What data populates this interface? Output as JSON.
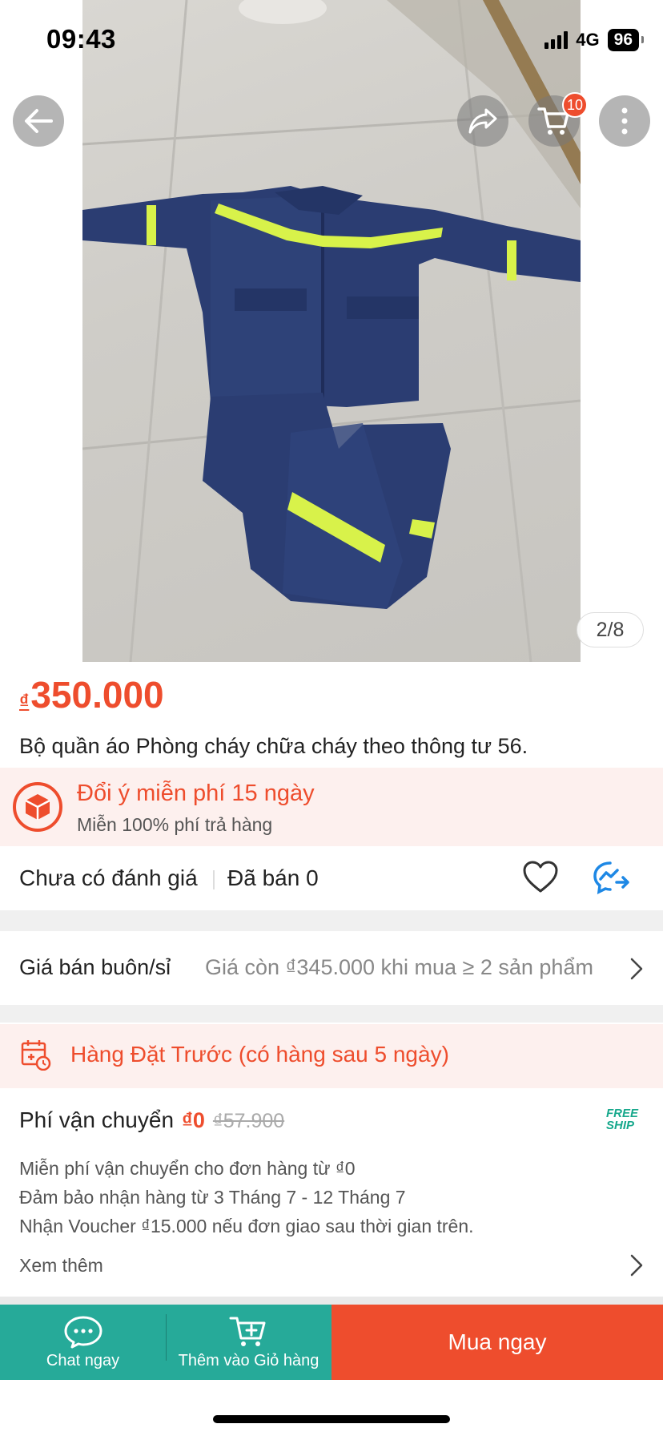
{
  "status_bar": {
    "time": "09:43",
    "network": "4G",
    "battery": "96"
  },
  "top_actions": {
    "cart_count": "10"
  },
  "gallery": {
    "counter": "2/8"
  },
  "product": {
    "currency_symbol": "₫",
    "price": "350.000",
    "title": "Bộ quần áo Phòng cháy chữa cháy theo thông tư 56."
  },
  "return_policy": {
    "title": "Đổi ý miễn phí 15 ngày",
    "subtitle": "Miễn 100% phí trả hàng"
  },
  "stats": {
    "rating": "Chưa có đánh giá",
    "sold": "Đã bán 0"
  },
  "wholesale": {
    "label": "Giá bán buôn/sỉ",
    "value": "Giá còn ₫345.000 khi mua ≥ 2 sản phẩm"
  },
  "preorder": {
    "text": "Hàng Đặt Trước (có hàng sau 5 ngày)"
  },
  "shipping": {
    "label": "Phí vận chuyển",
    "price": "₫0",
    "old_price": "₫57.900",
    "badge_line1": "FREE",
    "badge_line2": "SHIP",
    "lines": [
      "Miễn phí vận chuyển cho đơn hàng từ ₫0",
      "Đảm bảo nhận hàng từ 3 Tháng 7 - 12 Tháng 7",
      "Nhận Voucher ₫15.000 nếu đơn giao sau thời gian trên."
    ],
    "see_more": "Xem thêm"
  },
  "bottom_bar": {
    "chat_label": "Chat ngay",
    "cart_label": "Thêm vào Giỏ hàng",
    "buy_label": "Mua ngay"
  },
  "colors": {
    "accent": "#ee4d2d",
    "teal": "#26aa99",
    "uniform": "#2b3d72",
    "reflective": "#d8f24a"
  }
}
